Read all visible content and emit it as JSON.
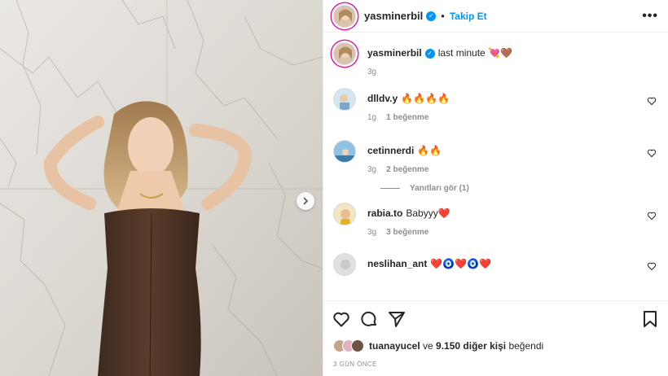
{
  "header": {
    "username": "yasminerbil",
    "separator": "•",
    "follow_label": "Takip Et",
    "more_label": "•••"
  },
  "caption": {
    "username": "yasminerbil",
    "text": "last minute 💘🤎",
    "time": "3g"
  },
  "comments": [
    {
      "username": "dlldv.y",
      "text": "🔥🔥🔥🔥",
      "time": "1g",
      "likes": "1 beğenme"
    },
    {
      "username": "cetinnerdi",
      "text": "🔥🔥",
      "time": "3g",
      "likes": "2 beğenme"
    },
    {
      "username": "rabia.to",
      "text": "Babyyy❤️",
      "time": "3g",
      "likes": "3 beğenme"
    },
    {
      "username": "neslihan_ant",
      "text": "❤️🧿❤️🧿❤️"
    }
  ],
  "view_replies": "Yanıtları gör (1)",
  "liked_by": {
    "user": "tuanayucel",
    "connector": " ve ",
    "others": "9.150 diğer kişi",
    "suffix": " beğendi"
  },
  "post_date": "3 GÜN ÖNCE",
  "icons": {
    "like": "heart-icon",
    "comment": "comment-icon",
    "share": "send-icon",
    "save": "bookmark-icon",
    "next": "chevron-right-icon"
  },
  "colors": {
    "accent": "#0095f6",
    "text": "#262626",
    "muted": "#8e8e8e"
  }
}
